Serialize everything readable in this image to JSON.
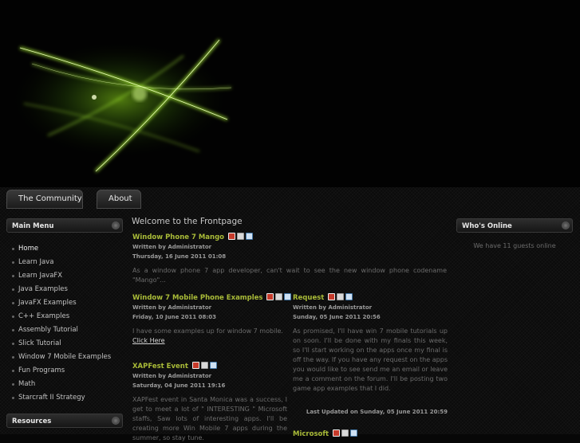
{
  "nav": {
    "tabs": [
      "The Community",
      "About"
    ]
  },
  "main_menu": {
    "title": "Main Menu",
    "items": [
      "Home",
      "Learn Java",
      "Learn JavaFX",
      "Java Examples",
      "JavaFX Examples",
      "C++ Examples",
      "Assembly Tutorial",
      "Slick Tutorial",
      "Window 7 Mobile Examples",
      "Fun Programs",
      "Math",
      "Starcraft II Strategy"
    ]
  },
  "resources": {
    "title": "Resources"
  },
  "page_title": "Welcome to the Frontpage",
  "articles": [
    {
      "title": "Window Phone 7 Mango",
      "author": "Written by Administrator",
      "date": "Thursday, 16 June 2011 01:08",
      "body": "As a window phone 7 app developer, can't wait to see the new window phone codename \"Mango\"..."
    },
    {
      "title": "Window 7 Mobile Phone Examples",
      "author": "Written by Administrator",
      "date": "Friday, 10 June 2011 08:03",
      "body": "I have some examples up for window 7 mobile.",
      "link": "Click Here"
    },
    {
      "title": "Request",
      "author": "Written by Administrator",
      "date": "Sunday, 05 June 2011 20:56",
      "body": "As promised, I'll have win 7 mobile tutorials up on soon. I'll be done with my finals this week, so I'll start working on the apps once my final is off the way. If you have any request on the apps you would like to see send me an email or leave me a comment on the forum. I'll be posting two game app examples that I did.",
      "updated": "Last Updated on Sunday, 05 June 2011 20:59"
    },
    {
      "title": "XAPFest Event",
      "author": "Written by Administrator",
      "date": "Saturday, 04 June 2011 19:16",
      "body": "XAPFest event in Santa Monica was a success, I get to meet a lot of \" INTERESTING \" Microsoft staffs, Saw lots of interesting apps. I'll be creating more Win Mobile 7 apps during the summer, so stay tune."
    },
    {
      "title": "Microsoft"
    }
  ],
  "whos_online": {
    "title": "Who's Online",
    "text": "We have 11 guests online"
  },
  "icons": [
    "pdf-icon",
    "print-icon",
    "email-icon"
  ],
  "colors": {
    "accent": "#a9bb38",
    "background": "#070707",
    "glow": "#9be020"
  }
}
